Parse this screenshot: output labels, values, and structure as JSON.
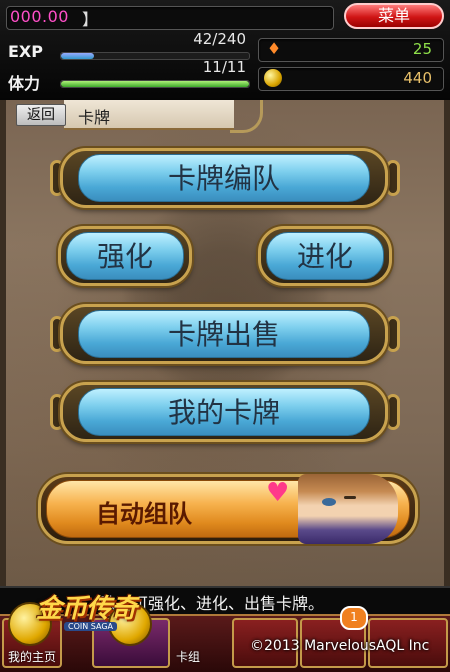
{
  "status": {
    "money": "000.00",
    "money_bracket": "】",
    "menu_label": "菜单",
    "exp_label": "EXP",
    "exp_value": "42/240",
    "exp_progress": 0.175,
    "hp_label": "体力",
    "hp_value": "11/11",
    "hp_progress": 1.0,
    "gems": "25",
    "coins": "440"
  },
  "nav": {
    "back_label": "返回",
    "title": "卡牌"
  },
  "menu": {
    "form_team": "卡牌编队",
    "enhance": "强化",
    "evolve": "进化",
    "sell": "卡牌出售",
    "my_cards": "我的卡牌",
    "auto_team": "自动组队"
  },
  "footer": {
    "message": "队、可强化、进化、出售卡牌。",
    "copyright": "©2013 MarvelousAQL Inc",
    "tab_home": "我的主页",
    "tab_deck": "卡组",
    "notification_count": "1"
  },
  "logo": {
    "title": "金币传奇",
    "subtitle": "COIN SAGA"
  },
  "colors": {
    "menu_red": "#d01515",
    "button_blue": "#4aa8d6",
    "gold_frame": "#c8a24e",
    "auto_orange": "#e08a1e"
  },
  "icons": [
    "gem-icon",
    "coin-icon",
    "heart-icon"
  ]
}
